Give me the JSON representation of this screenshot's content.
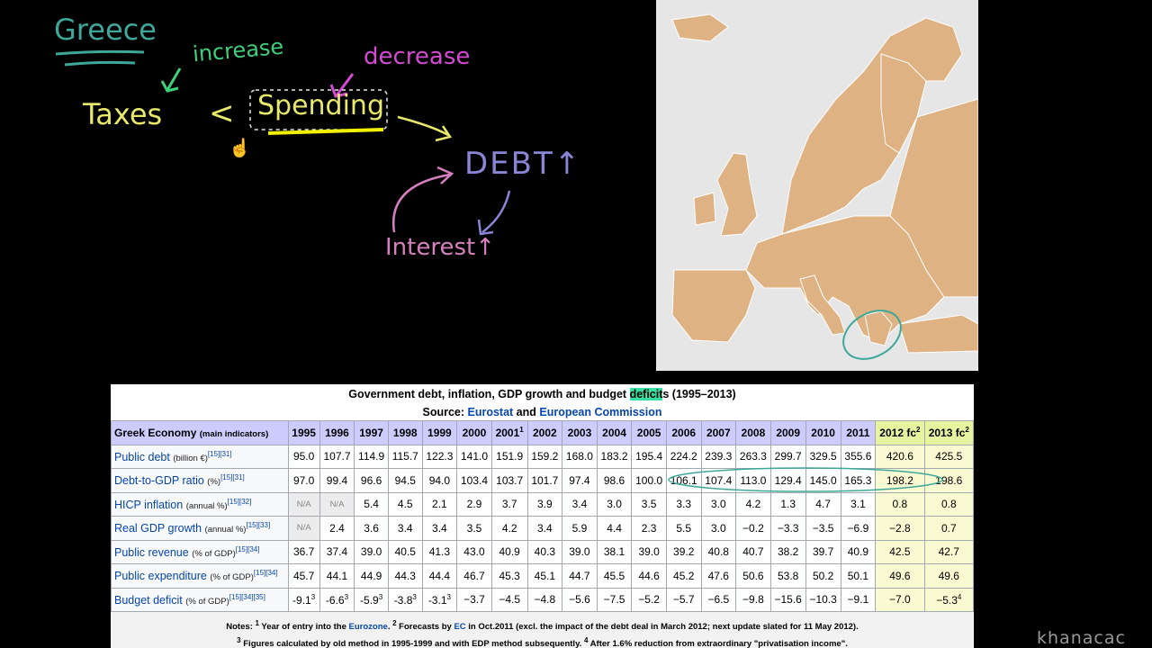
{
  "notes_board": {
    "greece": "Greece",
    "increase": "increase",
    "decrease": "decrease",
    "taxes": "Taxes",
    "less_than": "<",
    "spending": "Spending",
    "debt": "DEBT↑",
    "interest": "Interest↑"
  },
  "colors": {
    "greece": "#3fa79a",
    "increase": "#3ed07a",
    "decrease": "#d44ad0",
    "taxes": "#e8e86a",
    "spending": "#e8e86a",
    "debt": "#8a86d6",
    "interest": "#d680c0",
    "map_land": "#dfb283",
    "map_sea": "#e6e6e6",
    "circle": "#3fa79a"
  },
  "table": {
    "caption_pre": "Government debt, inflation, GDP growth and budget ",
    "caption_highlight": "deficit",
    "caption_post": "s (1995–2013)",
    "source_pre": "Source: ",
    "source_a": "Eurostat",
    "source_and": " and ",
    "source_b": "European Commission",
    "corner": "Greek Economy",
    "corner_small": "(main indicators)",
    "years": [
      "1995",
      "1996",
      "1997",
      "1998",
      "1999",
      "2000",
      "2001",
      "2002",
      "2003",
      "2004",
      "2005",
      "2006",
      "2007",
      "2008",
      "2009",
      "2010",
      "2011"
    ],
    "forecast_years": [
      "2012 fc",
      "2013 fc"
    ],
    "rows": [
      {
        "label": "Public debt",
        "unit": "(billion €)",
        "ref": "[15][31]",
        "values": [
          "95.0",
          "107.7",
          "114.9",
          "115.7",
          "122.3",
          "141.0",
          "151.9",
          "159.2",
          "168.0",
          "183.2",
          "195.4",
          "224.2",
          "239.3",
          "263.3",
          "299.7",
          "329.5",
          "355.6"
        ],
        "forecast": [
          "420.6",
          "425.5"
        ]
      },
      {
        "label": "Debt-to-GDP ratio",
        "unit": "(%)",
        "ref": "[15][31]",
        "values": [
          "97.0",
          "99.4",
          "96.6",
          "94.5",
          "94.0",
          "103.4",
          "103.7",
          "101.7",
          "97.4",
          "98.6",
          "100.0",
          "106.1",
          "107.4",
          "113.0",
          "129.4",
          "145.0",
          "165.3"
        ],
        "forecast": [
          "198.2",
          "198.6"
        ]
      },
      {
        "label": "HICP inflation",
        "unit": "(annual %)",
        "ref": "[15][32]",
        "values": [
          "N/A",
          "N/A",
          "5.4",
          "4.5",
          "2.1",
          "2.9",
          "3.7",
          "3.9",
          "3.4",
          "3.0",
          "3.5",
          "3.3",
          "3.0",
          "4.2",
          "1.3",
          "4.7",
          "3.1"
        ],
        "forecast": [
          "0.8",
          "0.8"
        ]
      },
      {
        "label": "Real GDP growth",
        "unit": "(annual %)",
        "ref": "[15][33]",
        "values": [
          "N/A",
          "2.4",
          "3.6",
          "3.4",
          "3.4",
          "3.5",
          "4.2",
          "3.4",
          "5.9",
          "4.4",
          "2.3",
          "5.5",
          "3.0",
          "−0.2",
          "−3.3",
          "−3.5",
          "−6.9"
        ],
        "forecast": [
          "−2.8",
          "0.7"
        ]
      },
      {
        "label": "Public revenue",
        "unit": "(% of GDP)",
        "ref": "[15][34]",
        "values": [
          "36.7",
          "37.4",
          "39.0",
          "40.5",
          "41.3",
          "43.0",
          "40.9",
          "40.3",
          "39.0",
          "38.1",
          "39.0",
          "39.2",
          "40.8",
          "40.7",
          "38.2",
          "39.7",
          "40.9"
        ],
        "forecast": [
          "42.5",
          "42.7"
        ]
      },
      {
        "label": "Public expenditure",
        "unit": "(% of GDP)",
        "ref": "[15][34]",
        "values": [
          "45.7",
          "44.1",
          "44.9",
          "44.3",
          "44.4",
          "46.7",
          "45.3",
          "45.1",
          "44.7",
          "45.5",
          "44.6",
          "45.2",
          "47.6",
          "50.6",
          "53.8",
          "50.2",
          "50.1"
        ],
        "forecast": [
          "49.6",
          "49.6"
        ]
      },
      {
        "label": "Budget deficit",
        "unit": "(% of GDP)",
        "ref": "[15][34][35]",
        "values": [
          "-9.1",
          "-6.6",
          "-5.9",
          "-3.8",
          "-3.1",
          "−3.7",
          "−4.5",
          "−4.8",
          "−5.6",
          "−7.5",
          "−5.2",
          "−5.7",
          "−6.5",
          "−9.8",
          "−15.6",
          "−10.3",
          "−9.1"
        ],
        "forecast": [
          "−7.0",
          "−5.3"
        ]
      }
    ],
    "notes_line1_a": "Notes: ",
    "notes_line1_b": " Year of entry into the ",
    "notes_eurozone": "Eurozone",
    "notes_line1_c": ". ",
    "notes_line1_d": " Forecasts by ",
    "notes_ec": "EC",
    "notes_line1_e": " in Oct.2011 (excl. the impact of the debt deal in March 2012; next update slated for 11 May 2012).",
    "notes_line2_a": " Figures calculated by old method in 1995-1999 and with EDP method subsequently. ",
    "notes_line2_b": " After 1.6% reduction from extraordinary \"privatisation income\"."
  },
  "watermark": "khanacac"
}
